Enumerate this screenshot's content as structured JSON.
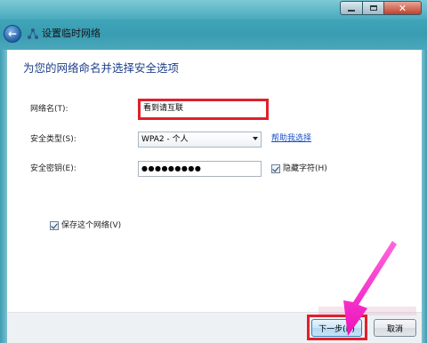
{
  "window": {
    "title": "设置临时网络",
    "icons": {
      "back": "back-arrow-icon",
      "network": "network-icon"
    },
    "controls": [
      "minimize",
      "maximize",
      "close"
    ]
  },
  "heading": "为您的网络命名并选择安全选项",
  "form": {
    "network_name": {
      "label": "网络名(T):",
      "value": "看到请互联"
    },
    "security_type": {
      "label": "安全类型(S):",
      "value": "WPA2 - 个人",
      "help_link": "帮助我选择"
    },
    "security_key": {
      "label": "安全密钥(E):",
      "value": "●●●●●●●●●",
      "hide_chars_label": "隐藏字符(H)",
      "hide_chars_checked": true
    },
    "save_network": {
      "label": "保存这个网络(V)",
      "checked": true
    }
  },
  "buttons": {
    "next": "下一步(N)",
    "cancel": "取消"
  },
  "colors": {
    "highlight": "#e0202c",
    "annotation_arrow": "#ff33cc",
    "heading": "#1e3f8a",
    "link": "#1a4fc8"
  }
}
